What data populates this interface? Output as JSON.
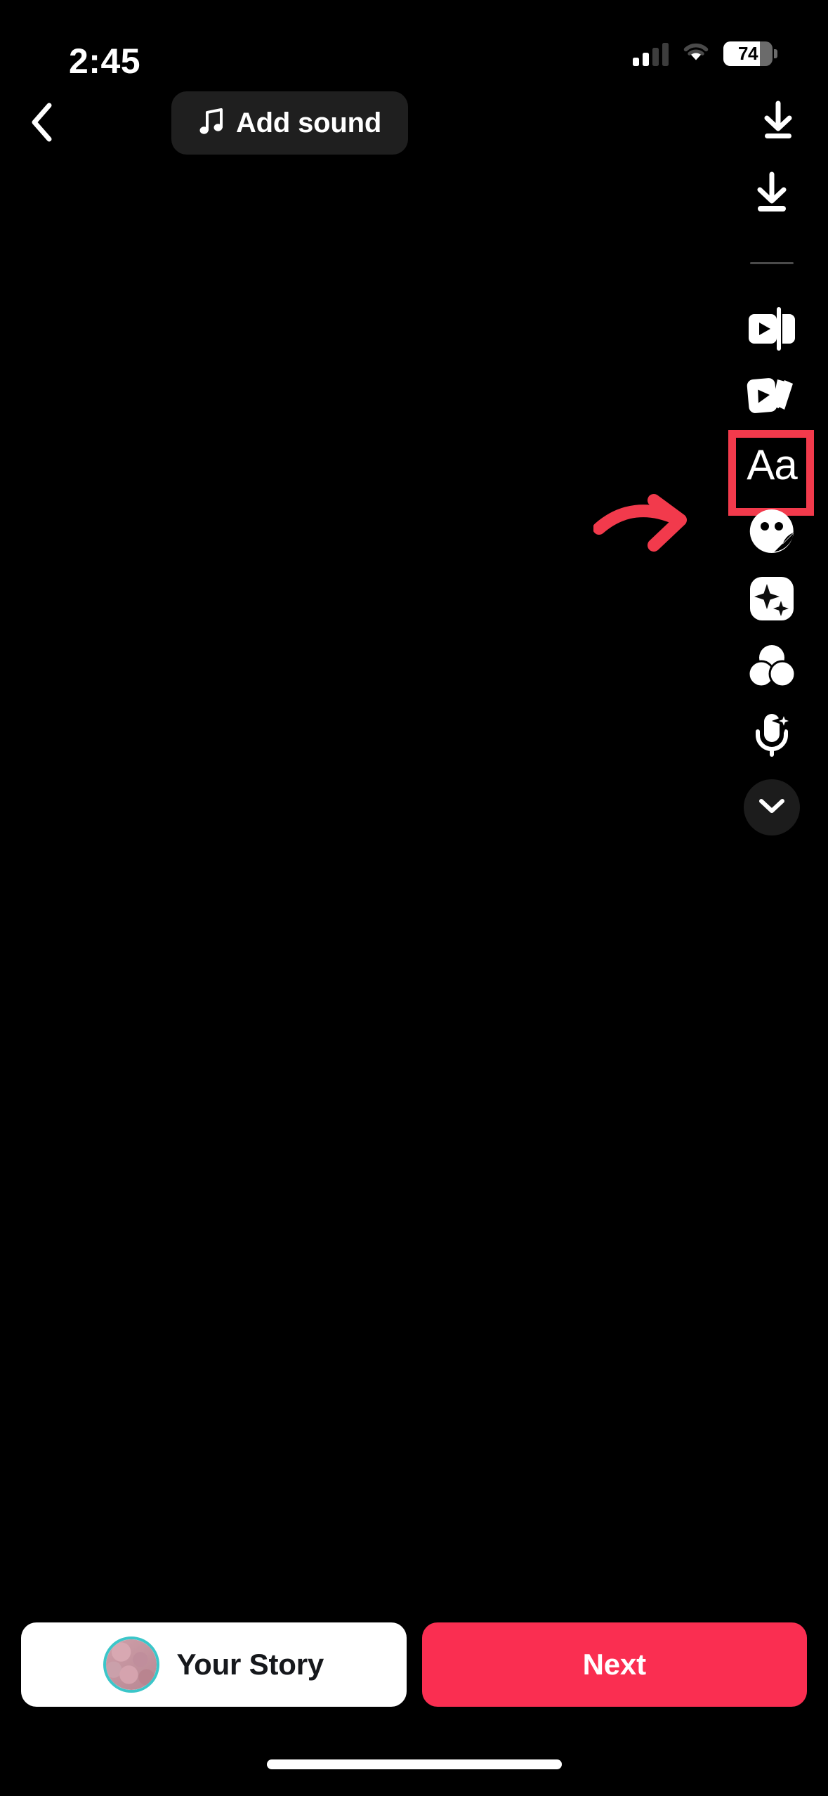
{
  "status_bar": {
    "time": "2:45",
    "battery_percent": "74",
    "battery_level": 74,
    "signal_icon": "cellular-signal-icon",
    "wifi_icon": "wifi-icon",
    "battery_icon": "battery-icon"
  },
  "top_bar": {
    "back_icon": "chevron-left-icon",
    "add_sound_label": "Add sound",
    "music_note_icon": "music-note-icon",
    "download_icon": "download-icon"
  },
  "tool_sidebar": {
    "items": [
      {
        "name": "download",
        "icon": "download-icon",
        "label": "Download",
        "highlighted": false
      },
      {
        "name": "divider",
        "icon": "divider",
        "label": "",
        "highlighted": false
      },
      {
        "name": "trim",
        "icon": "trim-video-icon",
        "label": "Trim",
        "highlighted": false
      },
      {
        "name": "clips",
        "icon": "clip-stack-icon",
        "label": "Clips",
        "highlighted": false
      },
      {
        "name": "text",
        "icon": "text-aa-icon",
        "label": "Aa",
        "highlighted": true
      },
      {
        "name": "stickers",
        "icon": "sticker-face-icon",
        "label": "Stickers",
        "highlighted": false
      },
      {
        "name": "effects",
        "icon": "sparkle-effects-icon",
        "label": "Effects",
        "highlighted": false
      },
      {
        "name": "filters",
        "icon": "filters-circles-icon",
        "label": "Filters",
        "highlighted": false
      },
      {
        "name": "voice-effects",
        "icon": "microphone-sparkle-icon",
        "label": "Voice effects",
        "highlighted": false
      },
      {
        "name": "more",
        "icon": "chevron-down-icon",
        "label": "More",
        "highlighted": false
      }
    ]
  },
  "annotation": {
    "arrow_icon": "curved-arrow-right-icon",
    "highlight_color": "#F23A4C",
    "target": "text-aa-icon"
  },
  "bottom_bar": {
    "your_story_label": "Your Story",
    "avatar_icon": "user-avatar",
    "next_label": "Next",
    "next_color": "#FA2E51"
  },
  "home_indicator": {
    "icon": "home-indicator"
  }
}
